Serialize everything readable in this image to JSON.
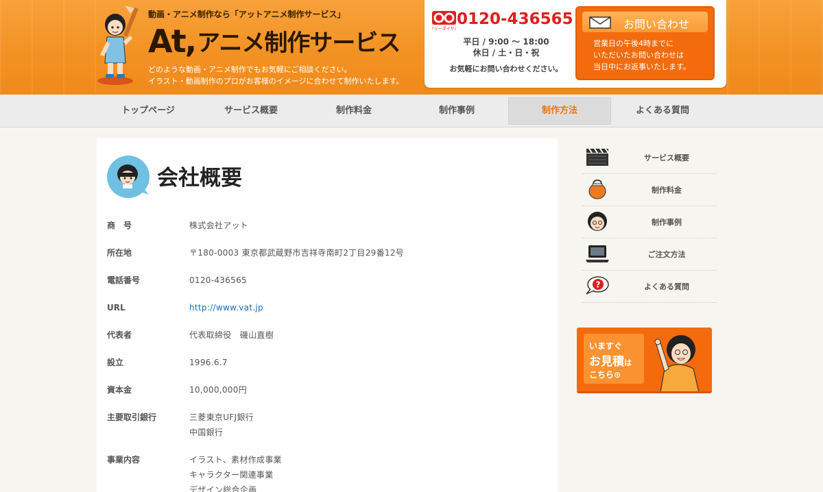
{
  "header": {
    "tagline_top": "動画・アニメ制作なら「アットアニメ制作サービス」",
    "logo_at": "At,",
    "logo_rest": "アニメ制作サービス",
    "tagline_sub_1": "どのような動画・アニメ制作でもお気軽にご相談ください。",
    "tagline_sub_2": "イラスト・動画制作のプロがお客様のイメージに合わせて制作いたします。",
    "freedial_label": "フリーダイヤル",
    "phone": "0120-436565",
    "hours_weekday": "平日 / 9:00 〜 18:00",
    "hours_holiday": "休日 / 土・日・祝",
    "hours_note": "お気軽にお問い合わせください。",
    "contact_button_label": "お問い合わせ",
    "contact_note_1": "営業日の午後4時までに",
    "contact_note_2": "いただいたお問い合わせは",
    "contact_note_3": "当日中にお返事いたします。"
  },
  "nav": {
    "items": [
      {
        "label": "トップページ"
      },
      {
        "label": "サービス概要"
      },
      {
        "label": "制作料金"
      },
      {
        "label": "制作事例"
      },
      {
        "label": "制作方法"
      },
      {
        "label": "よくある質問"
      }
    ],
    "active_index": 4
  },
  "main": {
    "title": "会社概要",
    "rows": [
      {
        "label": "商　号",
        "values": [
          "株式会社アット"
        ]
      },
      {
        "label": "所在地",
        "values": [
          "〒180-0003 東京都武蔵野市吉祥寺南町2丁目29番12号"
        ]
      },
      {
        "label": "電話番号",
        "values": [
          "0120-436565"
        ]
      },
      {
        "label": "URL",
        "link": "http://www.vat.jp"
      },
      {
        "label": "代表者",
        "values": [
          "代表取締役　磯山直樹"
        ]
      },
      {
        "label": "設立",
        "values": [
          "1996.6.7"
        ]
      },
      {
        "label": "資本金",
        "values": [
          "10,000,000円"
        ]
      },
      {
        "label": "主要取引銀行",
        "values": [
          "三菱東京UFJ銀行",
          "中国銀行"
        ]
      },
      {
        "label": "事業内容",
        "values": [
          "イラスト、素材作成事業",
          "キャラクター関連事業",
          "デザイン総合企画"
        ]
      }
    ]
  },
  "sidebar": {
    "items": [
      {
        "label": "サービス概要",
        "icon": "clapperboard-icon"
      },
      {
        "label": "制作料金",
        "icon": "coin-purse-icon"
      },
      {
        "label": "制作事例",
        "icon": "character-face-icon"
      },
      {
        "label": "ご注文方法",
        "icon": "laptop-icon"
      },
      {
        "label": "よくある質問",
        "icon": "question-bubble-icon"
      }
    ],
    "estimate": {
      "line1": "いますぐ",
      "line2": "お見積",
      "line2_suffix": "は",
      "line3": "こちら⊙"
    }
  },
  "colors": {
    "header_orange": "#f39224",
    "accent_orange": "#f46b0d",
    "phone_red": "#e01e1e",
    "link_blue": "#1a6bb8",
    "nav_active_text": "#e8770f"
  }
}
